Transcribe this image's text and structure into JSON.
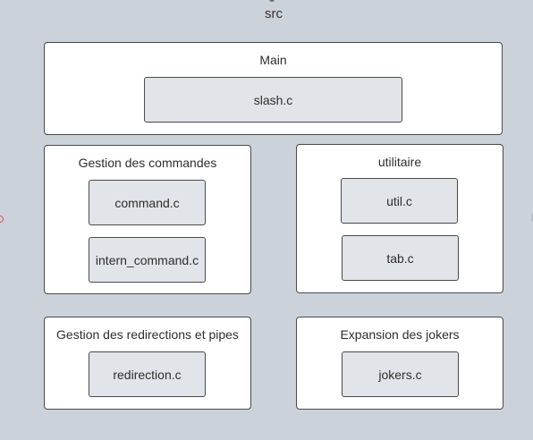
{
  "root": {
    "title": "src"
  },
  "groups": {
    "main": {
      "title": "Main",
      "files": [
        "slash.c"
      ]
    },
    "commands": {
      "title": "Gestion des commandes",
      "files": [
        "command.c",
        "intern_command.c"
      ]
    },
    "utils": {
      "title": "utilitaire",
      "files": [
        "util.c",
        "tab.c"
      ]
    },
    "redirections": {
      "title": "Gestion des redirections et pipes",
      "files": [
        "redirection.c"
      ]
    },
    "jokers": {
      "title": "Expansion des jokers",
      "files": [
        "jokers.c"
      ]
    }
  },
  "colors": {
    "canvas": "#ccd2da",
    "group_fill": "#ffffff",
    "file_fill": "#e1e4e9",
    "border": "#4a4a4a",
    "connector": "#e0505a"
  }
}
